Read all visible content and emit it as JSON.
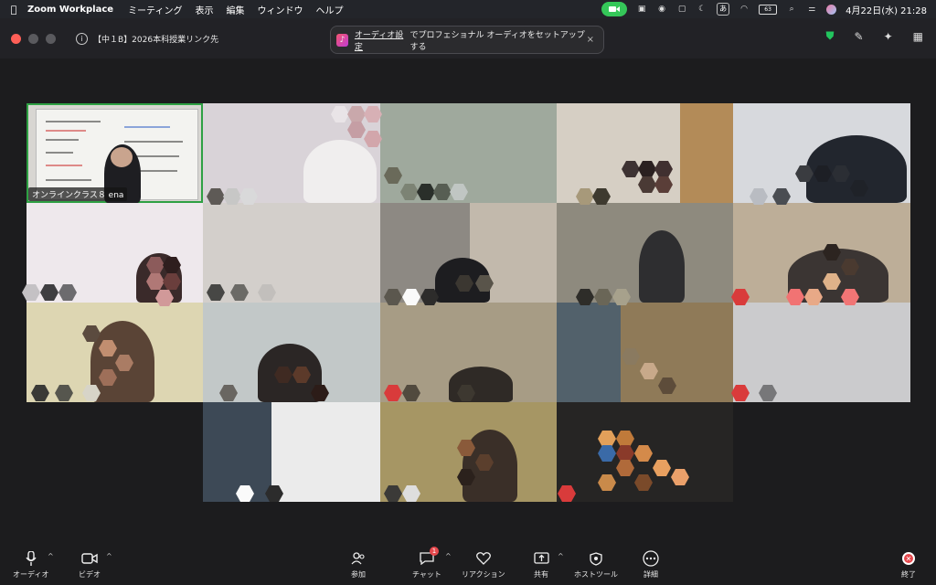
{
  "menubar": {
    "app_name": "Zoom Workplace",
    "items": [
      "ミーティング",
      "表示",
      "編集",
      "ウィンドウ",
      "ヘルプ"
    ],
    "input_method": "あ",
    "battery": "63",
    "datetime": "4月22日(水) 21:28"
  },
  "window": {
    "meeting_title": "【中１B】2026本科授業リンク先",
    "notice": {
      "link_text": "オーディオ設定",
      "text": "でプロフェショナル オーディオをセットアップする",
      "close": "×"
    }
  },
  "gallery": {
    "active_label": "オンラインクラス８ ena"
  },
  "toolbar": {
    "audio": "オーディオ",
    "video": "ビデオ",
    "participants": "参加",
    "chat": "チャット",
    "chat_badge": "1",
    "reactions": "リアクション",
    "share": "共有",
    "host_tools": "ホストツール",
    "more": "詳細",
    "end": "終了"
  },
  "colors": {
    "accent_green": "#35c759",
    "active_border": "#2ea043",
    "end_red": "#e5484d"
  }
}
